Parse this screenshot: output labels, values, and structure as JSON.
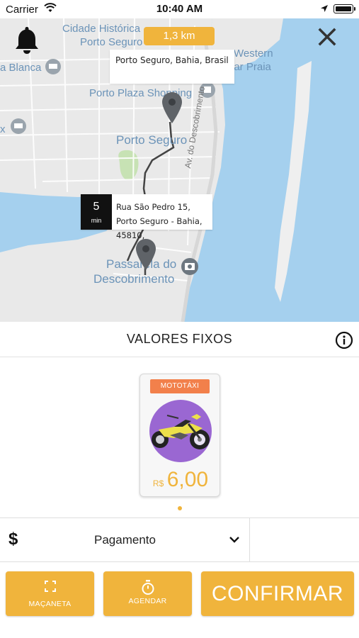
{
  "status_bar": {
    "carrier": "Carrier",
    "time": "10:40 AM"
  },
  "map": {
    "labels": {
      "cidade_historica": "Cidade Histórica",
      "porto_seguro_top": "Porto Seguro",
      "western": "Western",
      "mar_praia": "nar Praia",
      "la_blanca": "a Blanca",
      "plaza": "Porto Plaza Shopping",
      "porto_seguro_city": "Porto Seguro",
      "x_frag": "x",
      "av_descobrimento": "Av. do Descobrimento",
      "passarela": "Passarela do",
      "descobrimento": "Descobrimento"
    },
    "distance": "1,3 km",
    "destination": "Porto Seguro, Bahia, Brasil",
    "eta_value": "5",
    "eta_unit": "min",
    "origin": "Rua São Pedro 15, Porto Seguro - Bahia, 45810,"
  },
  "fixed_values": {
    "title": "VALORES FIXOS"
  },
  "vehicle": {
    "label": "MOTOTÁXI",
    "currency": "R$",
    "price": "6,00"
  },
  "payment": {
    "label": "Pagamento"
  },
  "actions": {
    "handle": "MAÇANETA",
    "schedule": "AGENDAR",
    "confirm": "CONFIRMAR"
  },
  "colors": {
    "accent": "#f0b43c",
    "badge": "#f2804b",
    "water": "#a5d0ee",
    "land": "#e9e9e9"
  }
}
